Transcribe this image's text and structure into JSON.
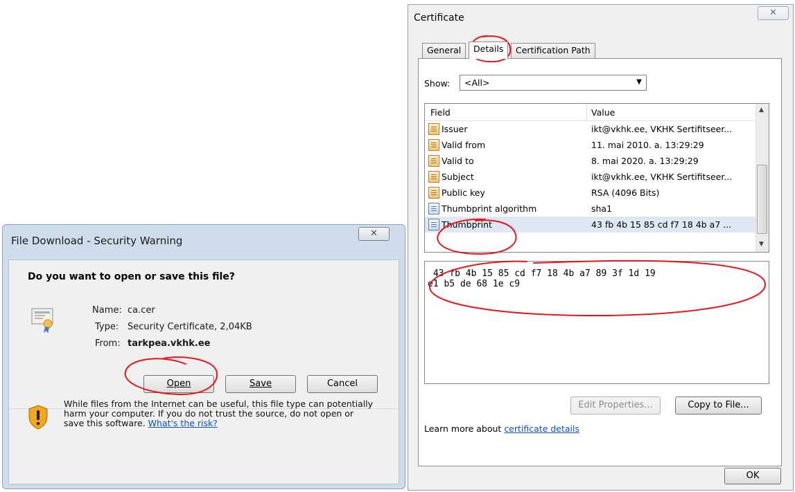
{
  "file_download": {
    "title": "File Download - Security Warning",
    "close_glyph": "X",
    "question": "Do you want to open or save this file?",
    "name_label": "Name:",
    "name_value": "ca.cer",
    "type_label": "Type:",
    "type_value": "Security Certificate, 2,04KB",
    "from_label": "From:",
    "from_value": "tarkpea.vkhk.ee",
    "open_button": "Open",
    "save_button": "Save",
    "cancel_button": "Cancel",
    "warning_text": "While files from the Internet can be useful, this file type can potentially harm your computer. If you do not trust the source, do not open or save this software.",
    "warning_link": "What's the risk?"
  },
  "certificate": {
    "title": "Certificate",
    "close_glyph": "X",
    "tabs": [
      {
        "label": "General",
        "active": false
      },
      {
        "label": "Details",
        "active": true
      },
      {
        "label": "Certification Path",
        "active": false
      }
    ],
    "show_label": "Show:",
    "show_value": "<All>",
    "columns": {
      "field": "Field",
      "value": "Value"
    },
    "rows": [
      {
        "field": "Issuer",
        "value": "ikt@vkhk.ee, VKHK Sertifitseer...",
        "icon": "certificate-field-icon"
      },
      {
        "field": "Valid from",
        "value": "11. mai 2010. a. 13:29:29",
        "icon": "certificate-field-icon"
      },
      {
        "field": "Valid to",
        "value": "8. mai 2020. a. 13:29:29",
        "icon": "certificate-field-icon"
      },
      {
        "field": "Subject",
        "value": "ikt@vkhk.ee, VKHK Sertifitseer...",
        "icon": "certificate-field-icon"
      },
      {
        "field": "Public key",
        "value": "RSA (4096 Bits)",
        "icon": "certificate-field-icon"
      },
      {
        "field": "Thumbprint algorithm",
        "value": "sha1",
        "icon": "property-icon"
      },
      {
        "field": "Thumbprint",
        "value": "43 fb 4b 15 85 cd f7 18 4b a7 ...",
        "icon": "property-icon",
        "selected": true
      }
    ],
    "value_text": " 43 fb 4b 15 85 cd f7 18 4b a7 89 3f 1d 19\ne1 b5 de 68 1e c9",
    "edit_properties_button": "Edit Properties...",
    "copy_to_file_button": "Copy to File...",
    "learn_more_prefix": "Learn more about ",
    "learn_more_link": "certificate details",
    "ok_button": "OK"
  },
  "colors": {
    "annotation_red": "#e8141a",
    "link_blue": "#0a50c8",
    "dialog_frame": "#cfdceb",
    "selected_row": "#dfe7f2"
  }
}
